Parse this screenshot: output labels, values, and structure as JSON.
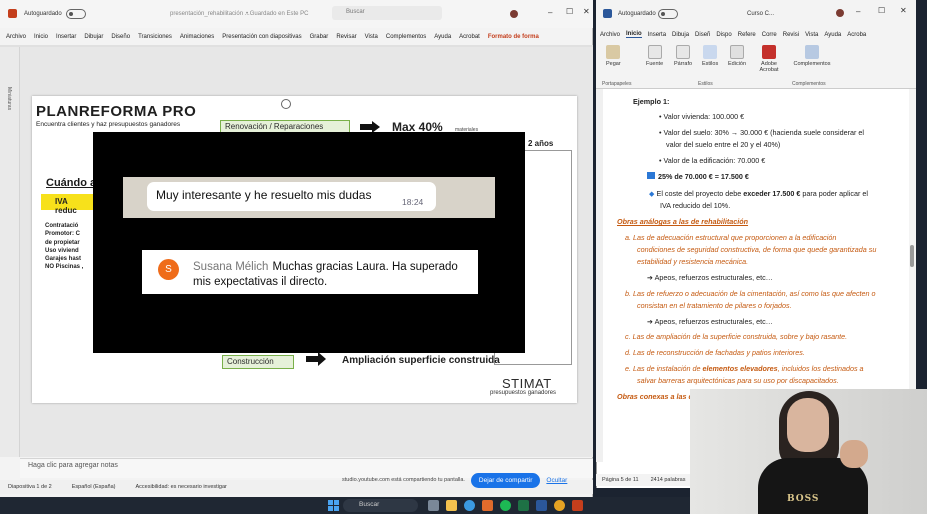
{
  "ppt": {
    "autosave_label": "Autoguardado",
    "filename": "presentación_rehabilitación ...",
    "saved_status": "• Guardado en Este PC",
    "search_placeholder": "Buscar",
    "menu": [
      "Archivo",
      "Inicio",
      "Insertar",
      "Dibujar",
      "Diseño",
      "Transiciones",
      "Animaciones",
      "Presentación con diapositivas",
      "Grabar",
      "Revisar",
      "Vista",
      "Complementos",
      "Ayuda",
      "Acrobat",
      "Formato de forma"
    ],
    "left_label": "Miniaturas",
    "notes_placeholder": "Haga clic para agregar notas",
    "status": [
      "Diapositiva 1 de 2",
      "Español (España)",
      "Accesibilidad: es necesario investigar"
    ]
  },
  "slide": {
    "logo": "PLANREFORMA PRO",
    "logo_sub": "Encuentra clientes y haz presupuestos ganadores",
    "reno_box": "Renovación / Reparaciones",
    "max": "Max 40%",
    "max_small": "materiales",
    "years": "2 años",
    "cuando": "Cuándo a",
    "iva_box": "IVA reduc",
    "bullets": [
      "Contratació",
      "Promotor: C",
      "de propietar",
      "Uso viviend",
      "Garajes hast",
      "NO Piscinas ,"
    ],
    "constr_box": "Construcción",
    "ampliacion": "Ampliación superficie construida",
    "brand": "STIMAT",
    "brand_sub": "presupuestos ganadores"
  },
  "overlay": {
    "chat_message": "Muy interesante y he resuelto mis dudas",
    "chat_time": "18:24",
    "comment_avatar": "S",
    "comment_author": "Susana Mélich",
    "comment_text": "Muchas gracias Laura. Ha superado mis expectativas il directo."
  },
  "share": {
    "message": "studio.youtube.com está compartiendo tu pantalla.",
    "button": "Dejar de compartir",
    "hide": "Ocultar"
  },
  "word": {
    "autosave_label": "Autoguardado",
    "filename": "Curso C...",
    "menu": [
      "Archivo",
      "Inicio",
      "Inserta",
      "Dibuja",
      "Diseñ",
      "Dispo",
      "Refere",
      "Corre",
      "Revisi",
      "Vista",
      "Ayuda",
      "Acroba"
    ],
    "ribbon": {
      "pegar": "Pegar",
      "fuente": "Fuente",
      "parrafo": "Párrafo",
      "estilos": "Estilos",
      "edicion": "Edición",
      "acrobat": "Adobe Acrobat",
      "complementos": "Complementos",
      "portapapeles": "Portapapeles",
      "estilos_group": "Estilos",
      "complementos_group": "Complementos"
    },
    "doc": {
      "ejemplo": "Ejemplo 1:",
      "valor_vivienda": "Valor vivienda: 100.000 €",
      "valor_suelo_1": "Valor del suelo: 30% → 30.000 € (hacienda suele considerar el",
      "valor_suelo_2": "valor del suelo entre el 20 y el 40%)",
      "valor_edif": "Valor de la edificación: 70.000 €",
      "calc": "25% de 70.000 € = 17.500 €",
      "coste_1": "El coste del proyecto debe",
      "coste_bold": "exceder 17.500 €",
      "coste_2": "para poder aplicar el",
      "coste_3": "IVA reducido del 10%.",
      "obras_title": "Obras análogas a las de rehabilitación",
      "a_1": "a.  Las de adecuación estructural que proporcionen a la edificación",
      "a_2": "condiciones de seguridad constructiva, de forma que quede garantizada su",
      "a_3": "estabilidad y resistencia mecánica.",
      "apeos_1": "➔ Apeos, refuerzos estructurales, etc…",
      "b_1": "b.  Las de refuerzo o adecuación de la cimentación, así como las que afecten o",
      "b_2": "consistan en el tratamiento de pilares o forjados.",
      "apeos_2": "➔ Apeos, refuerzos estructurales, etc…",
      "c": "c.  Las de ampliación de la superficie construida, sobre y bajo rasante.",
      "d": "d.  Las de reconstrucción de fachadas y patios interiores.",
      "e_1": "e.  Las de instalación de",
      "e_bold": "elementos elevadores",
      "e_2": ", incluidos los destinados a",
      "e_3": "salvar barreras arquitectónicas para su uso por discapacitados.",
      "conexas": "Obras conexas a las de"
    },
    "status": [
      "Página 5 de 11",
      "2414 palabras"
    ]
  },
  "webcam": {
    "shirt_text": "BOSS"
  },
  "taskbar": {
    "search_placeholder": "Buscar"
  }
}
